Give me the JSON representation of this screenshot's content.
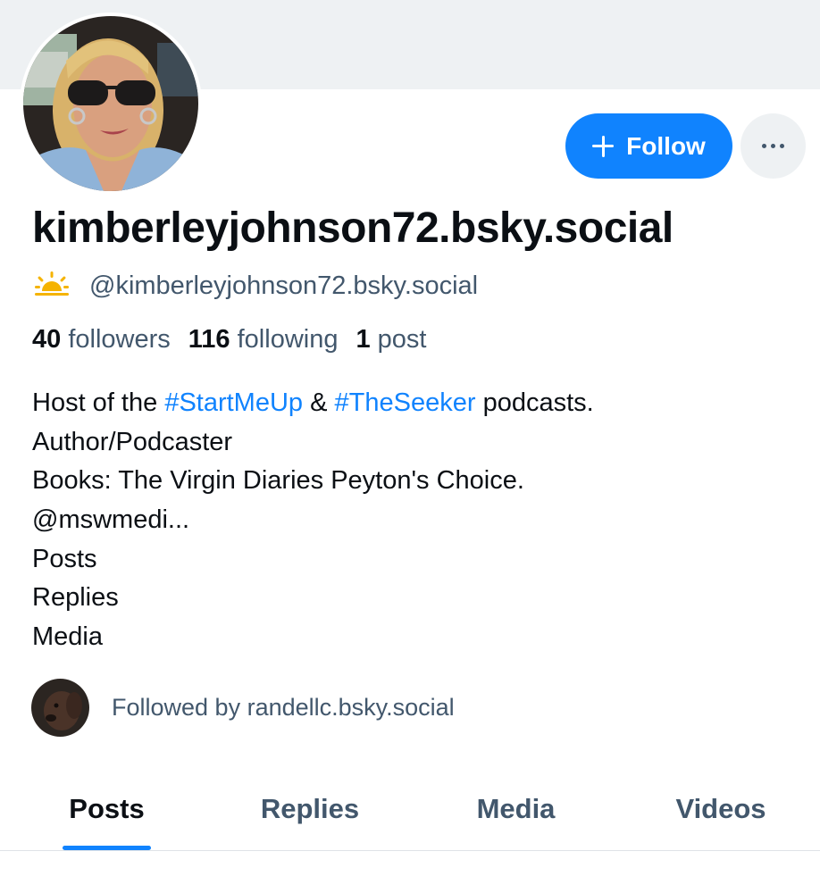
{
  "profile": {
    "display_name": "kimberleyjohnson72.bsky.social",
    "handle": "@kimberleyjohnson72.bsky.social",
    "handle_icon": "sunrise-icon"
  },
  "actions": {
    "follow_label": "Follow",
    "more_icon": "ellipsis-icon"
  },
  "stats": {
    "followers_count": "40",
    "followers_label": "followers",
    "following_count": "116",
    "following_label": "following",
    "posts_count": "1",
    "posts_label": "post"
  },
  "bio": {
    "line1_pre": "Host of the ",
    "tag1": "#StartMeUp",
    "line1_mid": " & ",
    "tag2": "#TheSeeker",
    "line1_post": " podcasts.",
    "line2": "Author/Podcaster",
    "line3": "Books: The Virgin Diaries Peyton's Choice.",
    "line4": "@mswmedi...",
    "line5": "Posts",
    "line6": "Replies",
    "line7": "Media"
  },
  "followed_by": {
    "text": "Followed by randellc.bsky.social"
  },
  "tabs": [
    {
      "label": "Posts",
      "active": true
    },
    {
      "label": "Replies",
      "active": false
    },
    {
      "label": "Media",
      "active": false
    },
    {
      "label": "Videos",
      "active": false
    }
  ],
  "colors": {
    "accent": "#1083fe",
    "muted_text": "#42576c",
    "banner": "#eef1f3",
    "sun": "#f5b301"
  }
}
